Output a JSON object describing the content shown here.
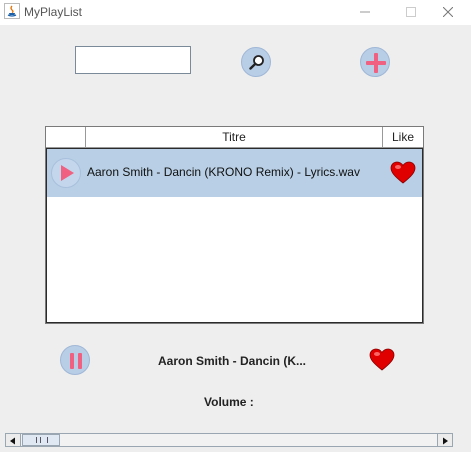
{
  "window": {
    "title": "MyPlayList",
    "app_icon": "java-icon",
    "controls": [
      "minimize-icon",
      "maximize-icon",
      "close-icon"
    ]
  },
  "toolbar": {
    "search_value": "",
    "search_placeholder": "",
    "search_icon": "magnifier-icon",
    "add_icon": "plus-icon"
  },
  "table": {
    "columns": [
      "",
      "Titre",
      "Like"
    ],
    "rows": [
      {
        "play_icon": "play-icon",
        "title": "Aaron Smith - Dancin (KRONO Remix) - Lyrics.wav",
        "like_icon": "heart-icon",
        "selected": true
      }
    ]
  },
  "player": {
    "pause_icon": "pause-icon",
    "now_playing": "Aaron Smith - Dancin (K...",
    "like_icon": "heart-icon",
    "volume_label": "Volume :"
  },
  "colors": {
    "accent_pink": "#f06080",
    "button_blue": "#b8cde6",
    "selection": "#b8cfe5",
    "heart_red": "#e00000"
  }
}
